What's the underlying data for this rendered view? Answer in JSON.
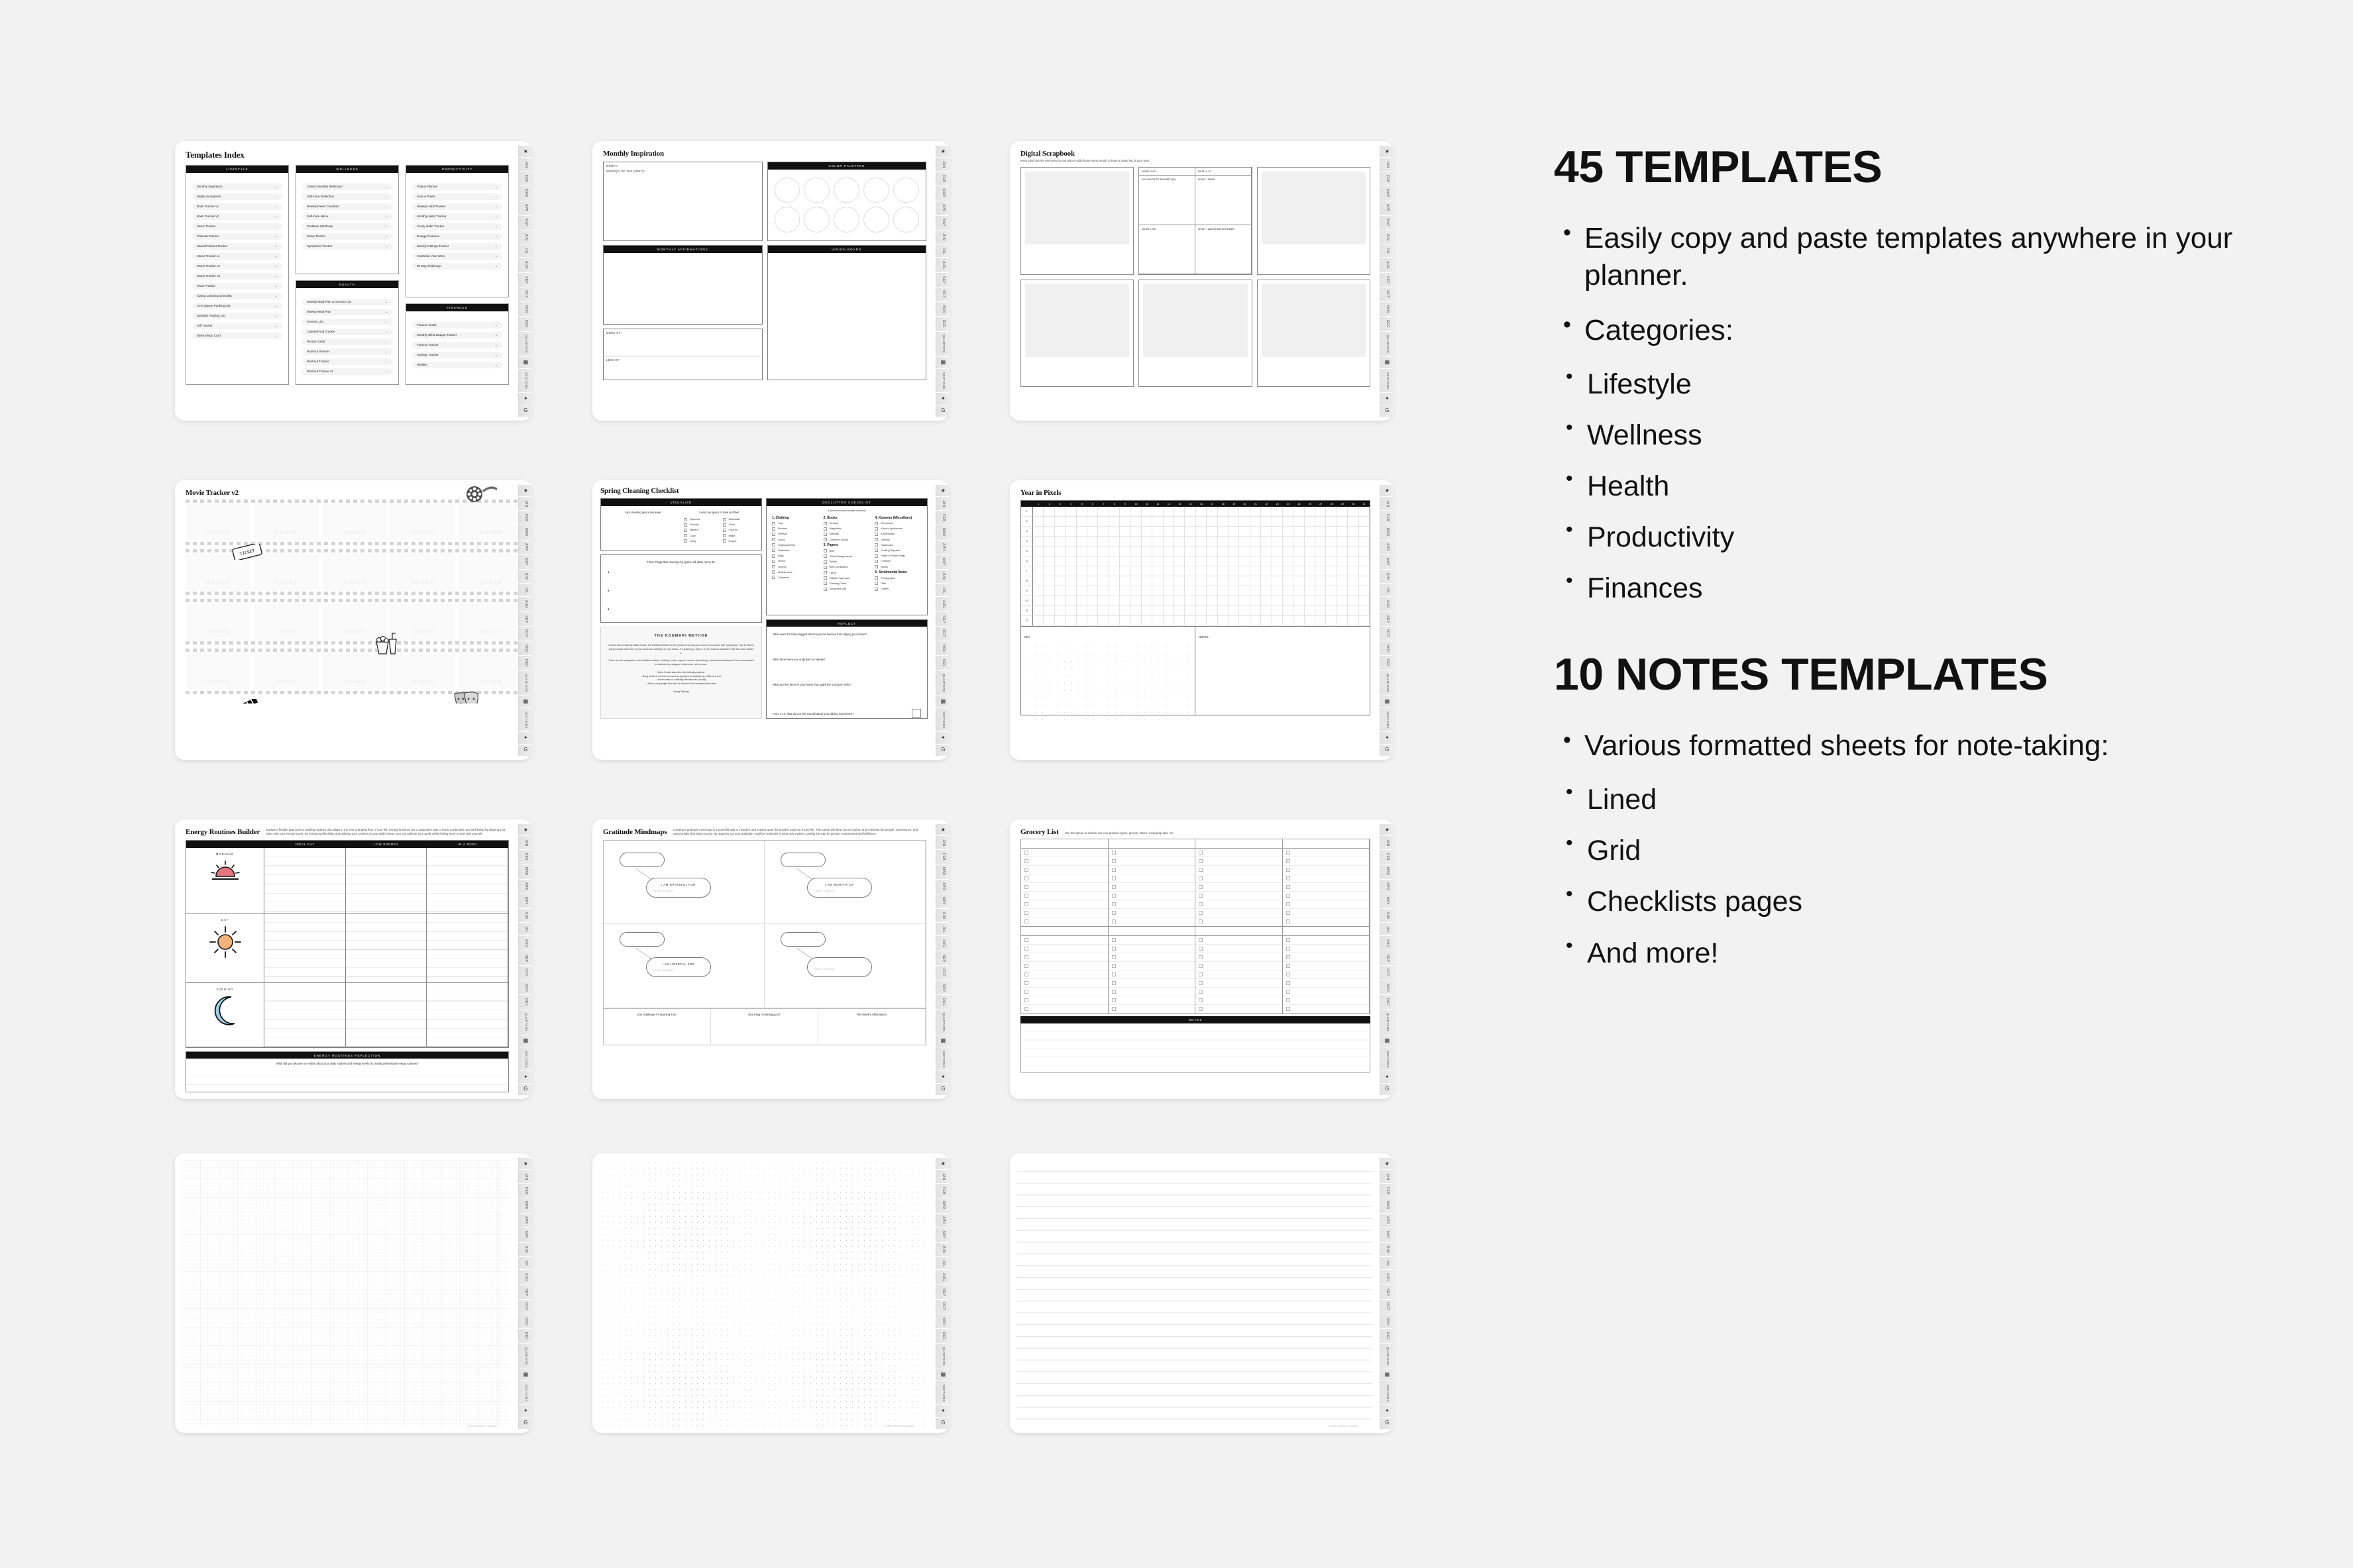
{
  "background_color": "#f2f2f2",
  "copy": {
    "heading_1": "45 TEMPLATES",
    "bullets_1": [
      "Easily copy and paste templates anywhere in your planner.",
      "Categories:"
    ],
    "categories": [
      "Lifestyle",
      "Wellness",
      "Health",
      "Productivity",
      "Finances"
    ],
    "heading_2": "10 NOTES TEMPLATES",
    "bullets_2": [
      "Various formatted sheets for note-taking:"
    ],
    "note_types": [
      "Lined",
      "Grid",
      "Checklists pages",
      "And more!"
    ]
  },
  "tabstrip": {
    "items": [
      "★",
      "JAN",
      "FEB",
      "MAR",
      "APR",
      "MAY",
      "JUN",
      "JUL",
      "AUG",
      "SEP",
      "OCT",
      "NOV",
      "DEC",
      "QUARTERS",
      "▦",
      "SECTIONS",
      "✦",
      "G"
    ]
  },
  "copyright": "© 2025 PASSION PLANNER",
  "templates": {
    "index": {
      "title": "Templates Index",
      "panels": [
        {
          "header": "LIFESTYLE",
          "items": [
            "Monthly Inspiration",
            "Digital Scrapbook",
            "Book Tracker v1",
            "Book Tracker v2",
            "Music Tracker",
            "Podcast Tracker",
            "Music/Podcast Tracker",
            "Movie Tracker v1",
            "Movie Tracker v2",
            "Movie Tracker v3",
            "Show Tracker",
            "Spring Cleaning Checklist",
            "At-a-Glance Packing List",
            "Detailed Packing List",
            "Gift Tracker",
            "Blank Bingo Card"
          ]
        },
        {
          "header": "WELLNESS",
          "items": [
            "Classic Monthly Reflection",
            "Self-Care Reflection",
            "Weekly Reset Checklist",
            "Self-Care Menu",
            "Gratitude Mindmap",
            "Sleep Tracker",
            "Symptoms Tracker"
          ]
        },
        {
          "header": "HEALTH",
          "items": [
            "Weekly Meal Plan & Grocery List",
            "Weekly Meal Plan",
            "Grocery List",
            "Calorie/Food Tracker",
            "Recipe Cards",
            "Workout Planner",
            "Workout Tracker",
            "Workout Tracker v2"
          ]
        },
        {
          "header": "PRODUCTIVITY",
          "items": [
            "Project Planner",
            "Year in Pixels",
            "Weekly Habit Tracker",
            "Monthly Habit Tracker",
            "Yearly Habit Tracker",
            "Energy Routines",
            "Weekly Ratings Tracker",
            "Celebrate Your Wins",
            "30 Day Challenge"
          ]
        },
        {
          "header": "FINANCES",
          "items": [
            "Finance Goals",
            "Monthly Bill & Budget Tracker",
            "Finance Tracker",
            "Savings Tracker",
            "Wishlist"
          ]
        }
      ],
      "arrow": "→"
    },
    "monthly_inspiration": {
      "title": "Monthly Inspiration",
      "field_month": "MONTH:",
      "field_word": "WORD(S) OF THE MONTH:",
      "header_palettes": "COLOR PALETTES",
      "header_affirmations": "MONTHLY AFFIRMATIONS",
      "header_vision": "VISION BOARD",
      "field_more": "MORE OF:",
      "field_less": "LESS OF:",
      "swatch_count": 10
    },
    "digital_scrapbook": {
      "title": "Digital Scrapbook",
      "subtitle": "Keep your favorite memories in one place! Add photos every month to have a visual log of your year.",
      "meta": [
        "MONTH OF:",
        "RATE 1-10:",
        "MY FAVORITE MOMENT(S)",
        "WHAT I READ",
        "WHAT I DID",
        "WHAT I WATCHED/LISTENED"
      ]
    },
    "movie_tracker": {
      "title": "Movie Tracker v2",
      "rows": 4,
      "frames_per_row": 5,
      "stars": "☆☆☆☆☆",
      "doodles": [
        "film-reel",
        "ticket",
        "popcorn-drink",
        "clapperboard",
        "theater-masks"
      ]
    },
    "spring_cleaning": {
      "title": "Spring Cleaning Checklist",
      "header_visualize": "VISUALIZE",
      "prompt_because": "I am cleaning space because:",
      "prompt_feel": "I want my space to look and feel:",
      "feelings_left": [
        "Spacious",
        "Friendly",
        "Modern",
        "Cozy",
        "Lively"
      ],
      "feelings_right": [
        "Minimalist",
        "Clean",
        "Colorful",
        "Bright",
        "Unique"
      ],
      "prompt_three": "Three things that cleaning my space will allow me to do:",
      "numbers": [
        "1",
        "2",
        "3"
      ],
      "konmari_title": "THE KONMARI METHOD",
      "konmari_p1": "Coined and created by Marie Kondo, the KonMari Method is the process of turning your home into a place that \"sparks joy.\" You do this by going through each item in your home and holding it in your hands. If it sparks joy, keep it. If not, express gratitude to the item and release it.",
      "konmari_p2": "There are five categories in the KonMari method: clothing, books, papers, komono (miscellany), and sentimental items. It is recommended to declutter by category in this order, not by room.",
      "konmari_p3": "Marie Kondo also offers the following advice:",
      "konmari_bullets": [
        "• Bring all items out into one area as opposed to decluttering a little at a time",
        "• Avoid music or watching television as you tidy",
        "• Touch every single item and be mindful of the emotions that arise"
      ],
      "konmari_close": "Happy Tidying!",
      "header_declutter": "DECLUTTER CHECKLIST",
      "declutter_note": "(Taken from the KonMari Method)",
      "categories": [
        {
          "name": "1. Clothing",
          "items": [
            "Tops",
            "Bottoms",
            "Dresses",
            "Socks",
            "Undergarments",
            "Outerwear",
            "Bags",
            "Shoes",
            "Jewelry",
            "Athletic wear",
            "Costumes"
          ]
        },
        {
          "name": "2. Books",
          "items": [
            "General",
            "Magazines",
            "Manuals",
            "Children's Books"
          ]
        },
        {
          "name": "3. Papers",
          "items": [
            "Bills",
            "School Assignments",
            "Syllabi",
            "Birth Certificates",
            "Taxes",
            "Official Paperwork",
            "Greeting Cards",
            "Unopened Mail"
          ]
        },
        {
          "name": "4. Komono (Miscellany)",
          "items": [
            "Electronics",
            "Kitchen Appliances",
            "Kitchenware",
            "Utensils",
            "Notebooks",
            "Crafting Supplies",
            "Paper or Plastic Bags",
            "Furniture",
            "Boxes"
          ]
        },
        {
          "name": "5. Sentimental Items",
          "items": [
            "Photographs",
            "Gifts",
            "Letters"
          ]
        }
      ],
      "header_reflect": "REFLECT",
      "reflect_questions": [
        "What were the three biggest lessons you've learned from tidying your home?",
        "What items were you surprised to release?",
        "What are five items in your home that spark the most joy? Why?",
        "From 1-10, how do you feel overall about your tidying experience?"
      ]
    },
    "year_in_pixels": {
      "title": "Year in Pixels",
      "day_columns": [
        "1",
        "2",
        "3",
        "4",
        "5",
        "6",
        "7",
        "8",
        "9",
        "10",
        "11",
        "12",
        "13",
        "14",
        "15",
        "16",
        "17",
        "18",
        "19",
        "20",
        "21",
        "22",
        "23",
        "24",
        "25",
        "26",
        "27",
        "28",
        "29",
        "30",
        "31"
      ],
      "month_rows": [
        "1",
        "2",
        "3",
        "4",
        "5",
        "6",
        "7",
        "8",
        "9",
        "10",
        "11",
        "12"
      ],
      "key_label": "KEY:",
      "notes_label": "NOTES:"
    },
    "energy_routines": {
      "title": "Energy Routines Builder",
      "subtitle": "Explore a flexible approach to building routines that adapt to the ever changing flow of your life! Energy Routines are a supportive way to boost productivity and well-being by aligning your tasks with your energy levels. By embracing flexibility and tailoring your routines to your daily energy, you can achieve your goals while feeling more in tune with yourself.",
      "columns": [
        "IDEAL DAY",
        "LOW ENERGY",
        "IN A RUSH"
      ],
      "rows": [
        {
          "label": "MORNING",
          "icon": "sunrise-icon",
          "color": "#e8757f"
        },
        {
          "label": "DAY",
          "icon": "sun-icon",
          "color": "#f3b27a"
        },
        {
          "label": "EVENING",
          "icon": "moon-icon",
          "color": "#9fcfe6"
        }
      ],
      "reflection_header": "ENERGY ROUTINES REFLECTION",
      "reflection_prompt": "What did you discover or realize about your daily routines and energy levels by creating intentional energy routines?"
    },
    "gratitude_mindmaps": {
      "title": "Gratitude Mindmaps",
      "subtitle": "Creating a gratitude mind map is a powerful way to visualize and expand upon the positive aspects of your life. This space will allow you to explore and celebrate the people, experiences, and opportunities that bring you joy. By mapping out your gratitude, you'll be reminded of what truly matters, paving the way for greater contentment and fulfillment.",
      "nodes": [
        "I AM GRATEFUL FOR",
        "I AM WORTHY OF",
        "I AM HOPEFUL FOR",
        ""
      ],
      "date_label": "TODAY'S DATE:",
      "footer": [
        "One challenge I'm learning from:",
        "One thing I'm letting go of:",
        "This Week's Affirmations:"
      ]
    },
    "grocery_list": {
      "title": "Grocery List",
      "subtitle": "Use this space to section out your produce types, grocery stores, meal prep lists, etc.",
      "columns": 4,
      "rows_per_block": 9,
      "blocks": 2,
      "notes_header": "NOTES"
    },
    "note_sheets": [
      {
        "name": "Grid note sheet",
        "style": "grid"
      },
      {
        "name": "Dot grid note sheet",
        "style": "dot"
      },
      {
        "name": "Lined note sheet",
        "style": "lined"
      }
    ]
  }
}
